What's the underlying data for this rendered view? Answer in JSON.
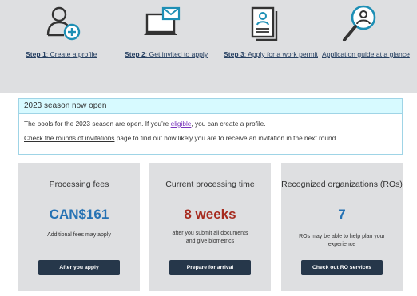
{
  "steps": [
    {
      "icon": "person-add-icon",
      "strong": "Step 1",
      "rest": ": Create a profile"
    },
    {
      "icon": "laptop-mail-icon",
      "strong": "Step 2",
      "rest": ": Get invited to apply"
    },
    {
      "icon": "document-id-icon",
      "strong": "Step 3",
      "rest": ": Apply for a work permit"
    },
    {
      "icon": "magnifier-person-icon",
      "strong": "",
      "rest": "Application guide at a glance"
    }
  ],
  "notice": {
    "title": "2023 season now open",
    "line1_before": "The pools for the 2023 season are open. If you’re ",
    "line1_link": "eligible",
    "line1_after": ", you can create a profile.",
    "line2_link": "Check the rounds of invitations",
    "line2_after": " page to find out how likely you are to receive an invitation in the next round."
  },
  "cards": [
    {
      "title": "Processing fees",
      "value": "CAN$161",
      "value_color": "#2572b4",
      "note": "Additional fees may apply",
      "button": "After you apply"
    },
    {
      "title": "Current processing time",
      "value": "8 weeks",
      "value_color": "#a62a1e",
      "note": "after you submit all documents and give biometrics",
      "button": "Prepare for arrival"
    },
    {
      "title": "Recognized organizations (ROs)",
      "value": "7",
      "value_color": "#2572b4",
      "note": "ROs may be able to help plan your experience",
      "button": "Check out RO services"
    }
  ]
}
